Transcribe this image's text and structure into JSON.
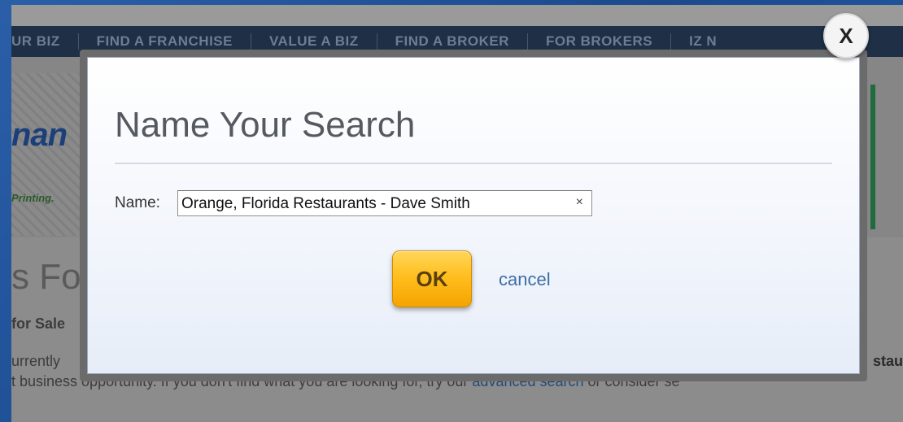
{
  "background_site": {
    "nav": {
      "items": [
        "UR BIZ",
        "FIND A FRANCHISE",
        "VALUE A BIZ",
        "FIND A BROKER",
        "FOR BROKERS",
        "IZ N"
      ]
    },
    "banner": {
      "logo_text": "nan",
      "tagline": "Printing."
    },
    "heading": "s Fo",
    "subheading": "for Sale",
    "body_line1": "urrently",
    "body_line1_right": "stau",
    "body_line2": {
      "prefix": "t business opportunity. If you don't find what you are looking for, try our ",
      "link": "advanced search",
      "suffix": " or consider se"
    }
  },
  "modal": {
    "title": "Name Your Search",
    "name_label": "Name:",
    "name_value": "Orange, Florida Restaurants - Dave Smith",
    "clear_glyph": "×",
    "ok_label": "OK",
    "cancel_label": "cancel",
    "close_label": "X"
  },
  "colors": {
    "frame_blue": "#1d4d8f",
    "ok_button": "#ffbf1f",
    "cancel_link": "#3d6ea3"
  }
}
